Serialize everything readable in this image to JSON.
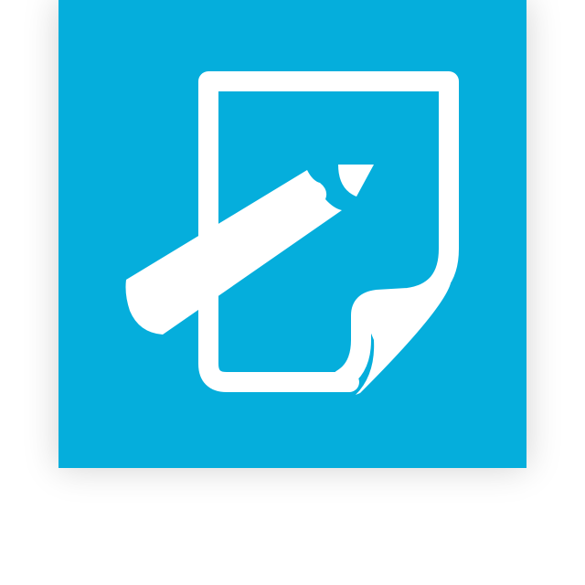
{
  "app_icon": {
    "icon": "edit-document-icon",
    "tile_color": "#05AEDC",
    "glyph_color": "#FFFFFF"
  }
}
